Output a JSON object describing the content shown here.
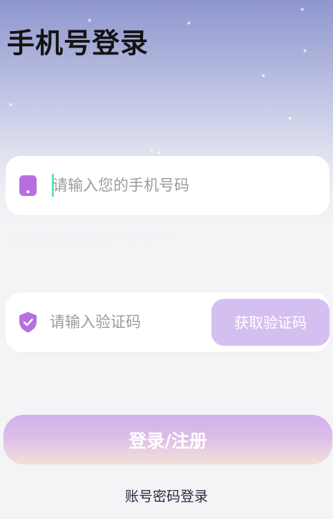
{
  "header": {
    "title": "手机号登录"
  },
  "phone_field": {
    "icon": "phone-icon",
    "placeholder": "请输入您的手机号码",
    "value": ""
  },
  "hint": {
    "text": "未注册手机号验证后将自动创建账号"
  },
  "code_field": {
    "icon": "shield-check-icon",
    "placeholder": "请输入验证码",
    "value": "",
    "get_code_label": "获取验证码"
  },
  "login_button": {
    "label": "登录/注册"
  },
  "account_login": {
    "label": "账号密码登录"
  },
  "colors": {
    "accent": "#b76fe0",
    "button_disabled": "#d4c0f0",
    "caret": "#5fe0b0"
  }
}
